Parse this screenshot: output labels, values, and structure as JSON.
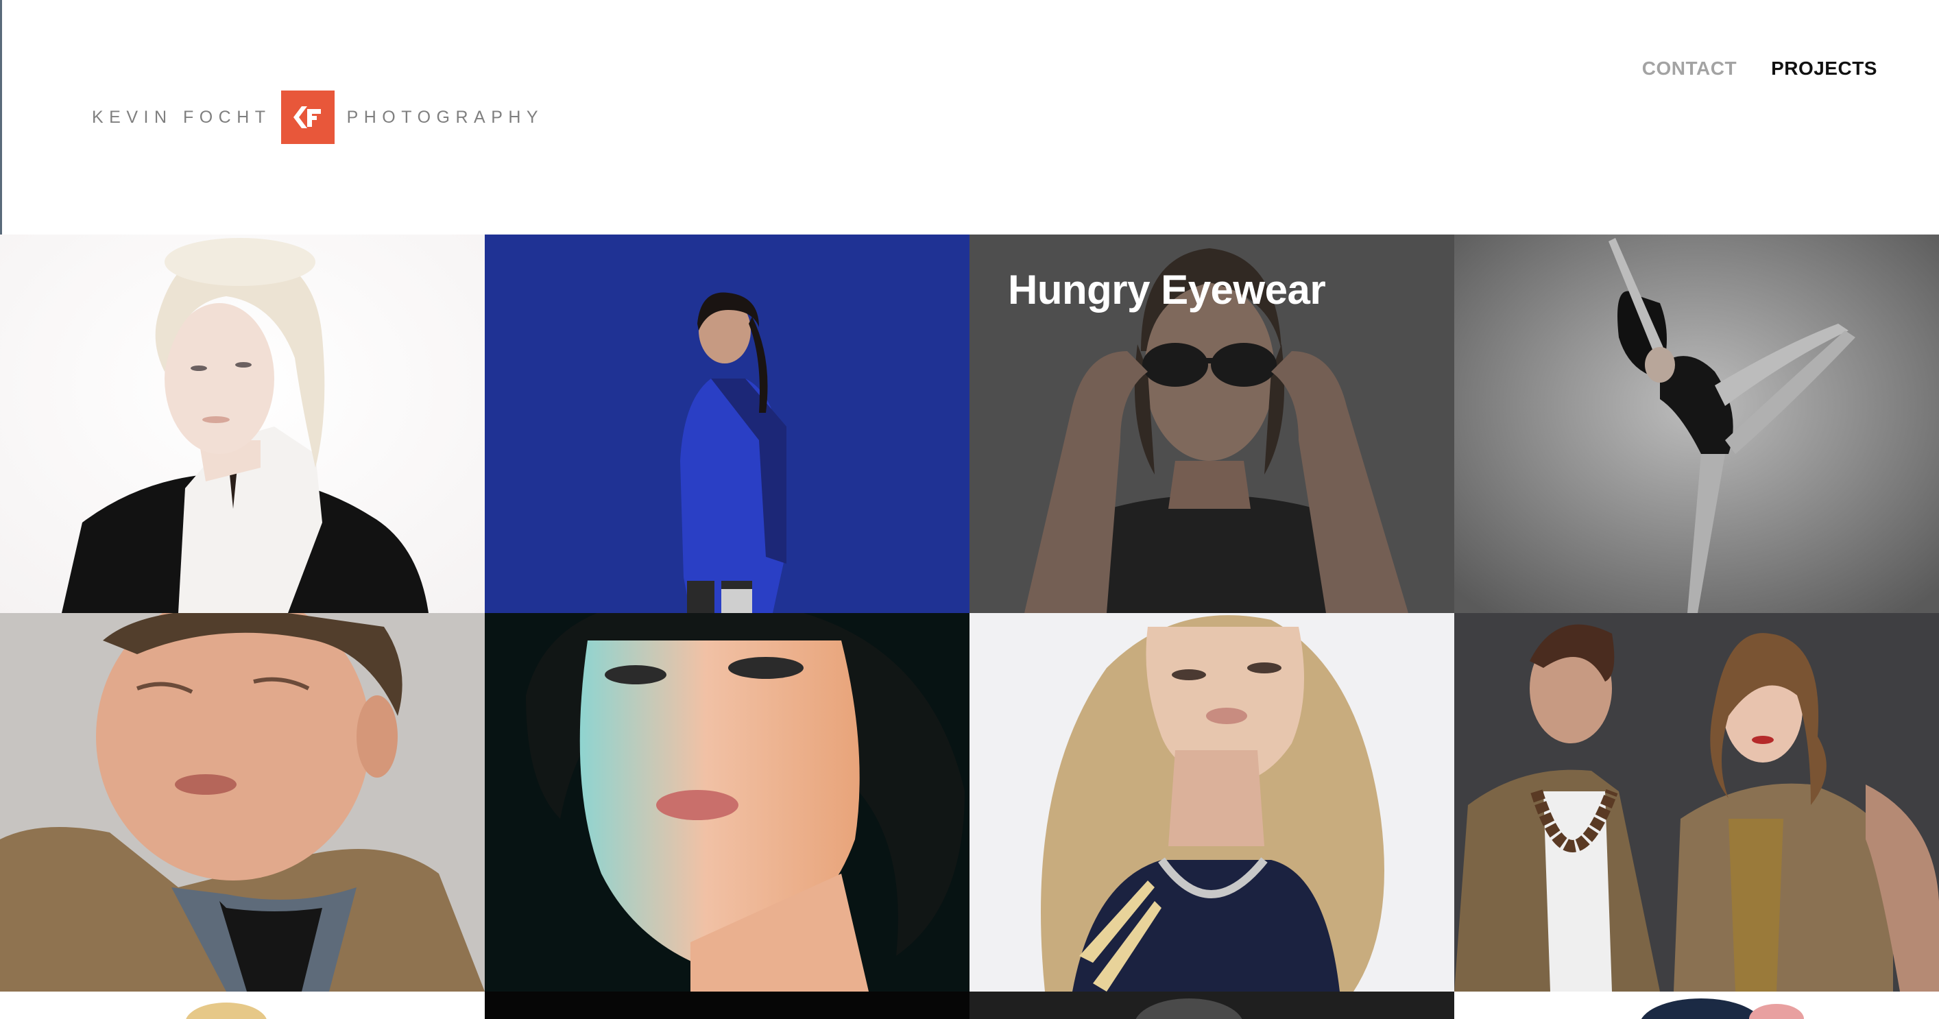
{
  "header": {
    "logo_left_text": "KEVIN FOCHT",
    "logo_right_text": "PHOTOGRAPHY",
    "logo_color": "#e8573a",
    "nav": {
      "contact_label": "CONTACT",
      "projects_label": "PROJECTS"
    }
  },
  "projects": [
    {
      "title": "",
      "icon": "portrait-platinum-hair"
    },
    {
      "title": "",
      "icon": "athlete-blue-jacket"
    },
    {
      "title": "Hungry Eyewear",
      "icon": "man-sunglasses"
    },
    {
      "title": "",
      "icon": "dancer-pose"
    },
    {
      "title": "",
      "icon": "man-winking"
    },
    {
      "title": "",
      "icon": "woman-makeup-teal"
    },
    {
      "title": "",
      "icon": "blonde-woman"
    },
    {
      "title": "",
      "icon": "couple-fashion"
    }
  ]
}
